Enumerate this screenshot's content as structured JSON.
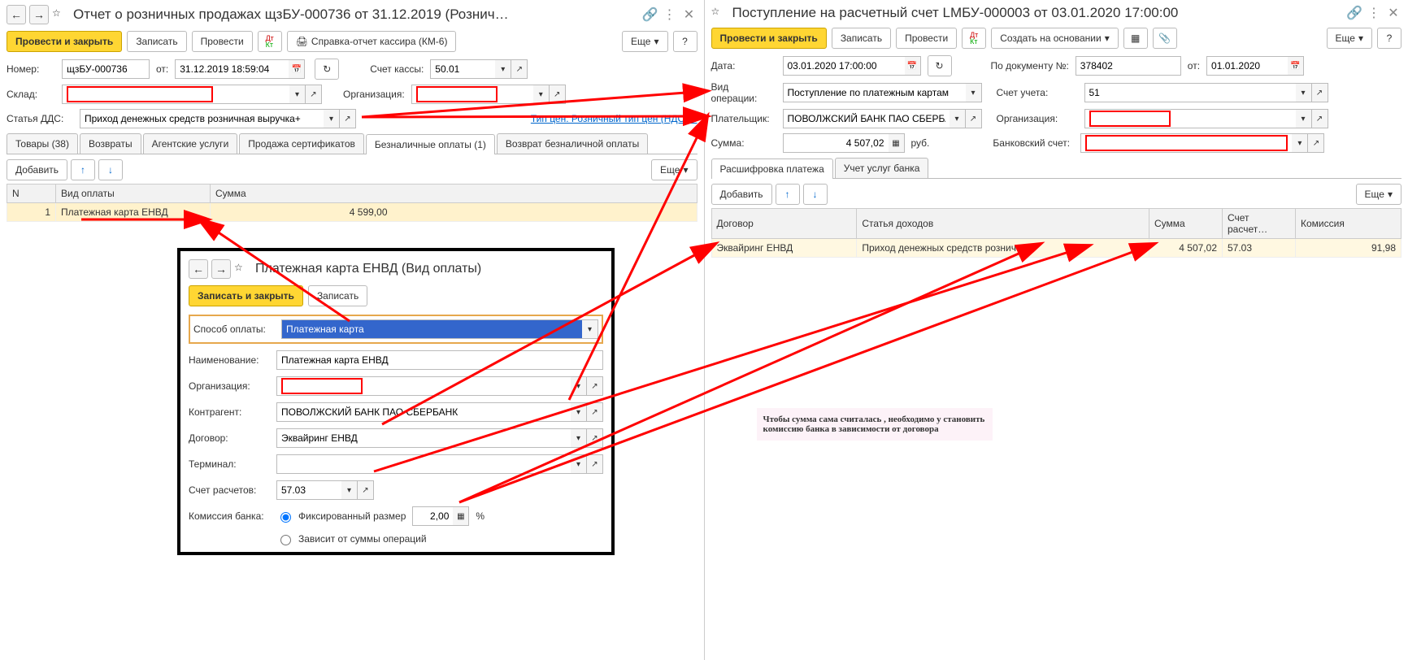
{
  "left": {
    "title": "Отчет о розничных продажах щзБУ-000736 от 31.12.2019 (Рознич…",
    "toolbar": {
      "post_close": "Провести и закрыть",
      "write": "Записать",
      "post": "Провести",
      "km6": "Справка-отчет кассира (КМ-6)",
      "more": "Еще"
    },
    "form": {
      "number_lbl": "Номер:",
      "number": "щзБУ-000736",
      "from_lbl": "от:",
      "date": "31.12.2019 18:59:04",
      "acct_lbl": "Счет кассы:",
      "acct": "50.01",
      "sklad_lbl": "Склад:",
      "org_lbl": "Организация:",
      "dds_lbl": "Статья ДДС:",
      "dds": "Приход денежных средств розничная выручка+",
      "price_type": "Тип цен: Розничный тип цен (НДС …"
    },
    "tabs": [
      "Товары (38)",
      "Возвраты",
      "Агентские услуги",
      "Продажа сертификатов",
      "Безналичные оплаты (1)",
      "Возврат безналичной оплаты"
    ],
    "tbl_toolbar": {
      "add": "Добавить",
      "more": "Еще"
    },
    "table": {
      "headers": {
        "n": "N",
        "type": "Вид оплаты",
        "sum": "Сумма"
      },
      "rows": [
        {
          "n": "1",
          "type": "Платежная карта ЕНВД",
          "sum": "4 599,00"
        }
      ]
    }
  },
  "popup": {
    "title": "Платежная карта ЕНВД (Вид оплаты)",
    "save_close": "Записать и закрыть",
    "write": "Записать",
    "method_lbl": "Способ оплаты:",
    "method": "Платежная карта",
    "name_lbl": "Наименование:",
    "name": "Платежная карта ЕНВД",
    "org_lbl": "Организация:",
    "contr_lbl": "Контрагент:",
    "contr": "ПОВОЛЖСКИЙ БАНК ПАО СБЕРБАНК",
    "dogovor_lbl": "Договор:",
    "dogovor": "Эквайринг ЕНВД",
    "terminal_lbl": "Терминал:",
    "acct_lbl": "Счет расчетов:",
    "acct": "57.03",
    "comm_lbl": "Комиссия банка:",
    "comm_fixed": "Фиксированный размер",
    "comm_val": "2,00",
    "comm_pct": "%",
    "comm_dep": "Зависит от суммы операций"
  },
  "right": {
    "title": "Поступление на расчетный счет LMБУ-000003 от 03.01.2020 17:00:00",
    "toolbar": {
      "post_close": "Провести и закрыть",
      "write": "Записать",
      "post": "Провести",
      "create": "Создать на основании",
      "more": "Еще"
    },
    "form": {
      "date_lbl": "Дата:",
      "date": "03.01.2020 17:00:00",
      "doc_lbl": "По документу №:",
      "doc_num": "378402",
      "doc_from_lbl": "от:",
      "doc_from": "01.01.2020",
      "oper_lbl": "Вид операции:",
      "oper": "Поступление по платежным картам",
      "acct_lbl": "Счет учета:",
      "acct": "51",
      "payer_lbl": "Плательщик:",
      "payer": "ПОВОЛЖСКИЙ БАНК ПАО СБЕРБАН",
      "org_lbl": "Организация:",
      "sum_lbl": "Сумма:",
      "sum": "4 507,02",
      "rub": "руб.",
      "bank_lbl": "Банковский счет:"
    },
    "tabs": [
      "Расшифровка платежа",
      "Учет услуг банка"
    ],
    "tbl_toolbar": {
      "add": "Добавить",
      "more": "Еще"
    },
    "table": {
      "headers": {
        "dog": "Договор",
        "stat": "Статья доходов",
        "sum": "Сумма",
        "acct": "Счет расчет…",
        "comm": "Комиссия"
      },
      "rows": [
        {
          "dog": "Эквайринг ЕНВД",
          "stat": "Приход денежных средств рознич…",
          "sum": "4 507,02",
          "acct": "57.03",
          "comm": "91,98"
        }
      ]
    }
  },
  "caption": "Чтобы сумма сама считалась , необходимо у становить комиссию банка в зависимости от договора"
}
